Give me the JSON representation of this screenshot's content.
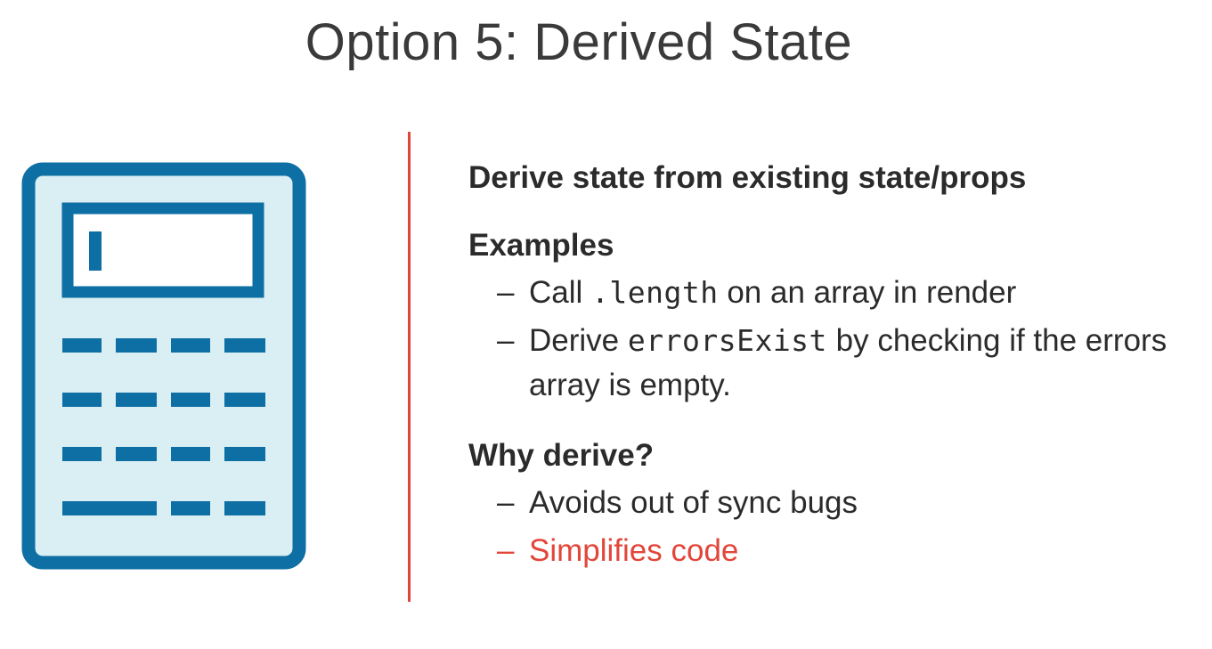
{
  "slide": {
    "title": "Option 5: Derived State",
    "headline": "Derive state from existing state/props",
    "examples": {
      "heading": "Examples",
      "items": [
        {
          "before": "Call ",
          "code": ".length",
          "after": " on an array in render"
        },
        {
          "before": "Derive ",
          "code": "errorsExist",
          "after": " by checking if the errors array is empty."
        }
      ]
    },
    "why": {
      "heading": "Why derive?",
      "items": [
        "Avoids out of sync bugs",
        "Simplifies code"
      ]
    },
    "bullet_char": "–",
    "icon": "calculator-icon",
    "colors": {
      "accent": "#e2463a",
      "icon_stroke": "#0e6fa4",
      "icon_fill": "#d9eff3"
    }
  }
}
